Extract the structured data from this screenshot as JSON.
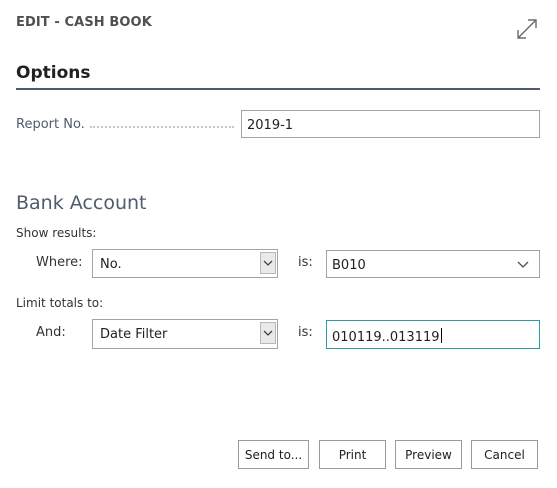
{
  "dialog": {
    "title": "EDIT - CASH BOOK"
  },
  "options": {
    "title": "Options",
    "report_no_label": "Report No.",
    "report_no_value": "2019-1"
  },
  "bank_account": {
    "title": "Bank Account",
    "show_results_label": "Show results:",
    "where_label": "Where:",
    "where_field": "No.",
    "where_is_label": "is:",
    "where_value": "B010",
    "limit_totals_label": "Limit totals to:",
    "and_label": "And:",
    "and_field": "Date Filter",
    "and_is_label": "is:",
    "and_value": "010119..013119"
  },
  "buttons": {
    "send_to": "Send to...",
    "print": "Print",
    "preview": "Preview",
    "cancel": "Cancel"
  },
  "icons": [
    "expand-icon",
    "chevron-down-icon"
  ]
}
